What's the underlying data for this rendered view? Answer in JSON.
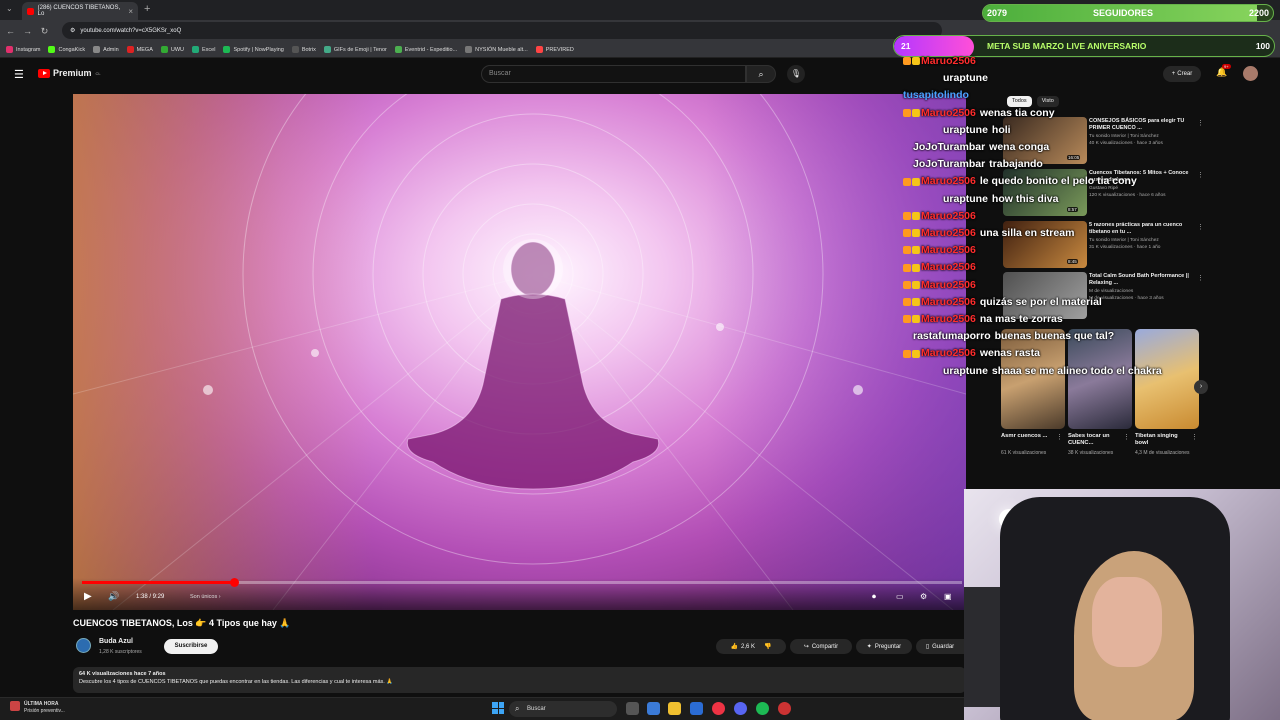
{
  "browser": {
    "tab_title": "(286) CUENCOS TIBETANOS, Lo",
    "url": "youtube.com/watch?v=cX5GKSr_xoQ",
    "bookmarks": [
      "Instagram",
      "CongaKick",
      "Admin",
      "MEGA",
      "UWU",
      "Excel",
      "Spotify | NowPlaying",
      "Botrix",
      "GIFs de Emoji | Tenor",
      "Eventrid - Expeditio...",
      "NYSIÓN Mueble alt...",
      "PREVIRED"
    ]
  },
  "youtube": {
    "logo_text": "Premium",
    "logo_region": "CL",
    "search_placeholder": "Buscar",
    "create_label": "Crear",
    "notif_count": "9+"
  },
  "player": {
    "time": "1:38 / 9:29",
    "chapter": "Son únicos",
    "progress_fraction": 0.1722
  },
  "video": {
    "title": "CUENCOS TIBETANOS, Los 👉 4 Tipos que hay 🙏",
    "channel": "Buda Azul",
    "subscribers": "1,28 K suscriptores",
    "subscribe_label": "Suscribirse",
    "likes": "2,6 K",
    "share_label": "Compartir",
    "ask_label": "Preguntar",
    "save_label": "Guardar",
    "meta": "64 K visualizaciones  hace 7 años",
    "description": "Descubre los 4 tipos de CUENCOS TIBETANOS que puedas encontrar en las tiendas. Las diferencias y cual te interesa más. 🙏"
  },
  "sidebar": {
    "chips": [
      "Todos",
      "Visto"
    ],
    "recommendations": [
      {
        "title": "CONSEJOS BÁSICOS para elegir TU PRIMER CUENCO ...",
        "channel": "Tu sonido Interior | Toni Sánchez",
        "views": "40 K visualizaciones · hace 3 años",
        "duration": "16:05"
      },
      {
        "title": "Cuencos Tibetanos: 5 Mitos + Conoce sus verdaderos ...",
        "channel": "Gustavo Ripé",
        "views": "120 K visualizaciones · hace 6 años",
        "duration": "8:57"
      },
      {
        "title": "5 razones prácticas para un cuenco tibetano en tu ...",
        "channel": "Tu sonido Interior | Toni Sánchez",
        "views": "31 K visualizaciones · hace 1 año",
        "duration": "8:45"
      },
      {
        "title": "Total Calm Sound Bath Performance || Relaxing ...",
        "channel": "M de visualizaciones",
        "views": "M de visualizaciones · hace 3 años",
        "duration": ""
      }
    ],
    "shorts": [
      {
        "title": "Asmr cuencos ...",
        "views": "61 K visualizaciones"
      },
      {
        "title": "Sabes tocar un CUENC...",
        "views": "38 K visualizaciones"
      },
      {
        "title": "Tibetan singing bowl",
        "views": "4,3 M de visualizaciones"
      }
    ]
  },
  "overlay": {
    "followers_current": "2079",
    "followers_label": "SEGUIDORES",
    "followers_goal": "2200",
    "followers_fraction": 0.945,
    "sub_current": "21",
    "sub_label": "META SUB MARZO LIVE ANIVERSARIO",
    "sub_goal": "100",
    "sub_fraction": 0.21
  },
  "chat": [
    {
      "user": "Maruo2506",
      "message": "",
      "color": "red"
    },
    {
      "user": "uraptune",
      "message": "",
      "color": "white"
    },
    {
      "user": "tusapitolindo",
      "message": "",
      "color": "blue"
    },
    {
      "user": "Maruo2506",
      "message": "wenas tia cony",
      "color": "red"
    },
    {
      "user": "uraptune",
      "message": "holi",
      "color": "white"
    },
    {
      "user": "JoJoTurambar",
      "message": "wena conga",
      "color": "white"
    },
    {
      "user": "JoJoTurambar",
      "message": "trabajando",
      "color": "white"
    },
    {
      "user": "Maruo2506",
      "message": "le quedo bonito el pelo tia cony",
      "color": "red"
    },
    {
      "user": "uraptune",
      "message": "how this diva",
      "color": "white"
    },
    {
      "user": "Maruo2506",
      "message": "",
      "color": "red"
    },
    {
      "user": "Maruo2506",
      "message": "una silla en stream",
      "color": "red"
    },
    {
      "user": "Maruo2506",
      "message": "",
      "color": "red"
    },
    {
      "user": "Maruo2506",
      "message": "",
      "color": "red"
    },
    {
      "user": "Maruo2506",
      "message": "",
      "color": "red"
    },
    {
      "user": "Maruo2506",
      "message": "quizás se por el material",
      "color": "red"
    },
    {
      "user": "Maruo2506",
      "message": "na mas te zorras",
      "color": "red"
    },
    {
      "user": "rastafumaporro",
      "message": "buenas buenas que tal?",
      "color": "white"
    },
    {
      "user": "Maruo2506",
      "message": "wenas rasta",
      "color": "red"
    },
    {
      "user": "uraptune",
      "message": "shaaa se me alineo todo el chakra",
      "color": "white"
    }
  ],
  "taskbar": {
    "news_title": "ÚLTIMA HORA",
    "news_sub": "Prisión preventiv...",
    "search_label": "Buscar"
  }
}
